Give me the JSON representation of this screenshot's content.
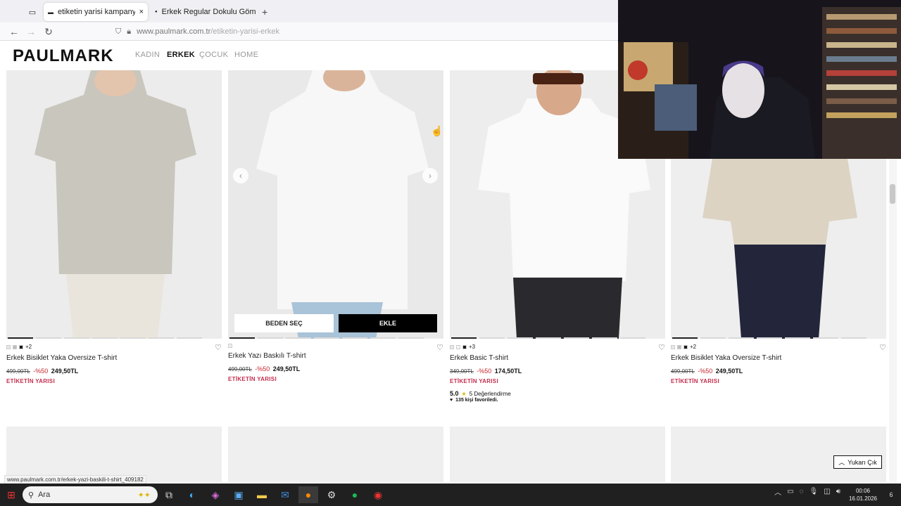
{
  "browser": {
    "tabs": [
      {
        "label": "etiketin yarisi kampanyasi erkek"
      },
      {
        "label": "Erkek Regular Dokulu Gömlek"
      }
    ],
    "new_tab": "+",
    "close_tab": "×",
    "url_host": "www.paulmark.com.tr",
    "url_path": "/etiketin-yarisi-erkek"
  },
  "site": {
    "logo": "PAULMARK",
    "menu": [
      "KADIN",
      "ERKEK",
      "ÇOCUK",
      "HOME"
    ],
    "active_menu": "ERKEK"
  },
  "products": [
    {
      "name": "Erkek Bisiklet Yaka Oversize T-shirt",
      "more_colors": "+2",
      "old_price": "499,00TL",
      "discount": "-%50",
      "price": "249,50TL",
      "campaign": "ETİKETİN YARISI",
      "swatches": [
        "#e8e8e8",
        "#bdbdbd",
        "#1a1a1a"
      ],
      "photo": "#d6d3ca"
    },
    {
      "name": "Erkek Yazı Baskılı T-shirt",
      "more_colors": "",
      "old_price": "499,00TL",
      "discount": "-%50",
      "price": "249,50TL",
      "campaign": "ETİKETİN YARISI",
      "swatches": [
        "#f0f0f0"
      ],
      "photo": "#e6e6e6",
      "btn_size": "BEDEN SEÇ",
      "btn_add": "EKLE"
    },
    {
      "name": "Erkek Basic T-shirt",
      "more_colors": "+3",
      "old_price": "349,00TL",
      "discount": "-%50",
      "price": "174,50TL",
      "campaign": "ETİKETİN YARISI",
      "swatches": [
        "#e8e8e8",
        "#f5f5f5",
        "#1a1a1a"
      ],
      "photo": "#ebebeb",
      "rating": "5.0",
      "reviews": "5 Değerlendirme",
      "favorites": "135 kişi favoriledi."
    },
    {
      "name": "Erkek Bisiklet Yaka Oversize T-shirt",
      "more_colors": "+2",
      "old_price": "499,00TL",
      "discount": "-%50",
      "price": "249,50TL",
      "campaign": "ETİKETİN YARISI",
      "swatches": [
        "#e8e8e8",
        "#bdbdbd",
        "#1a1a1a"
      ],
      "photo": "#e9e9e9"
    }
  ],
  "scroll_top": "Yukarı Çık",
  "status_url": "www.paulmark.com.tr/erkek-yazi-baskili-t-shirt_409182",
  "taskbar": {
    "search_placeholder": "Ara",
    "time": "00:06",
    "date": "16.01.2026",
    "notifications": "6"
  }
}
